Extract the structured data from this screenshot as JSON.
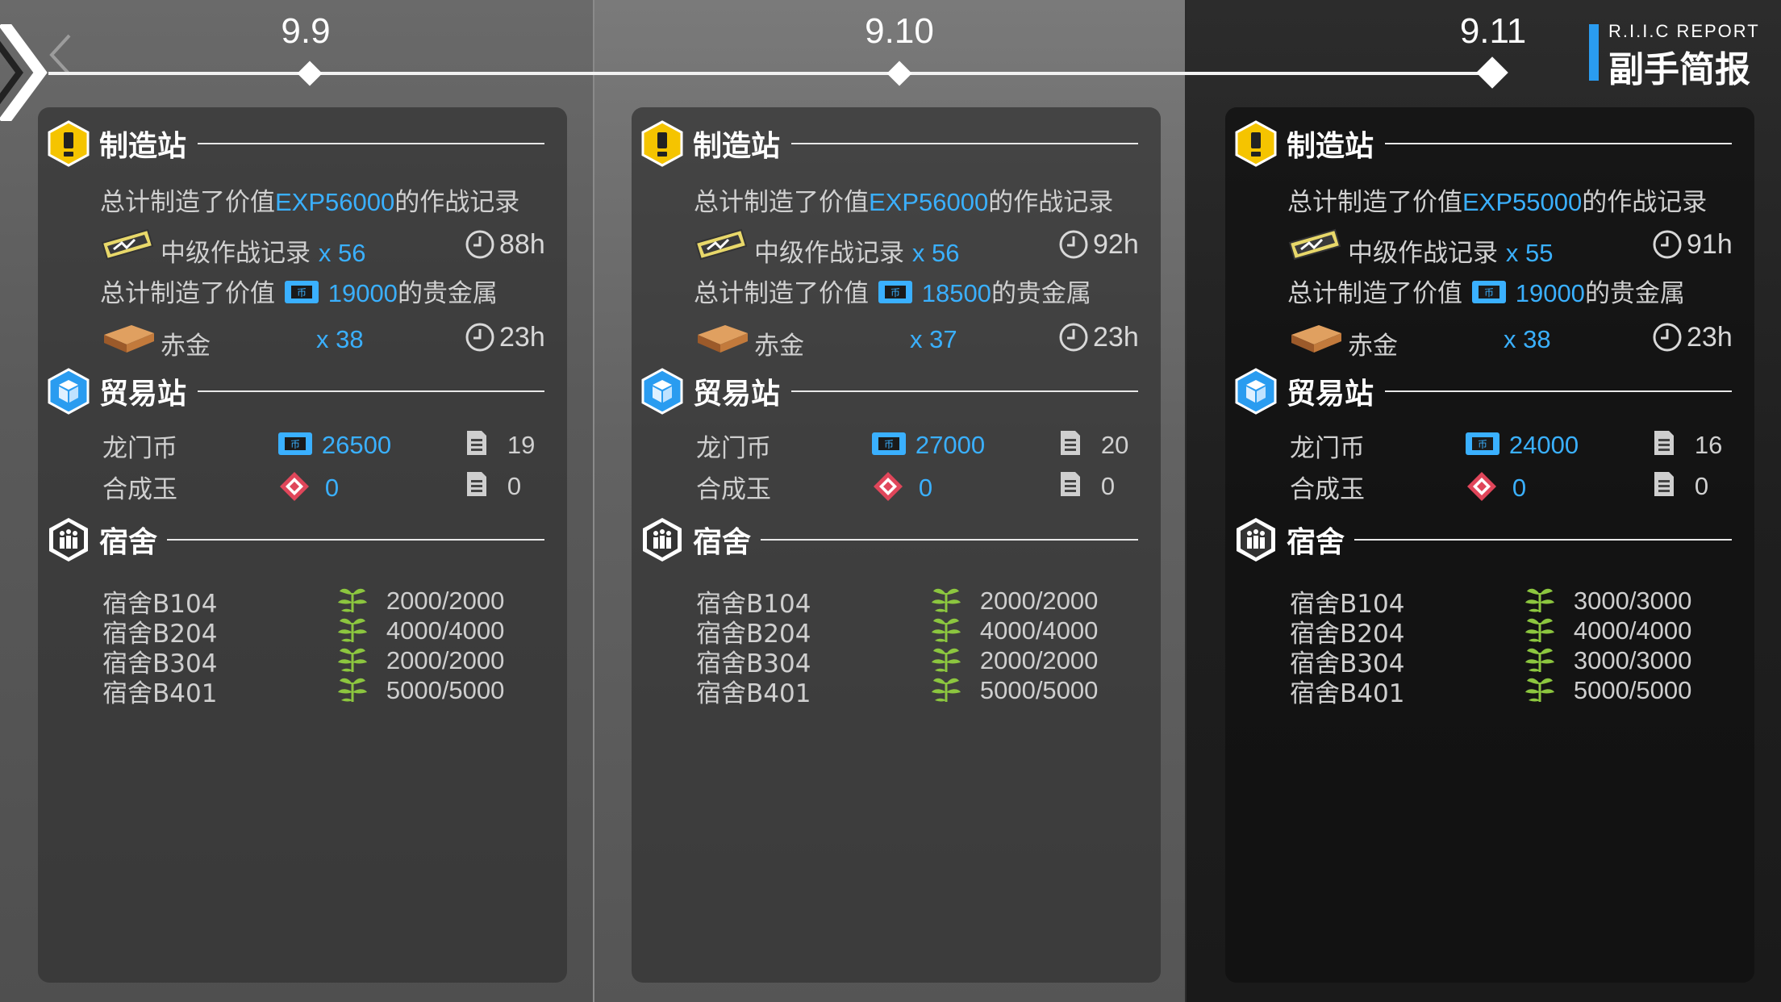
{
  "header": {
    "report_en": "R.I.I.C REPORT",
    "report_cn": "副手简报"
  },
  "timeline": {
    "dates": [
      "9.9",
      "9.10",
      "9.11"
    ]
  },
  "labels": {
    "manufacture": "制造站",
    "trade": "贸易站",
    "dorm": "宿舍",
    "exp_prefix": "总计制造了价值",
    "exp_suffix": "的作战记录",
    "gold_prefix": "总计制造了价值",
    "gold_suffix": "的贵金属",
    "record_name": "中级作战记录",
    "gold_name": "赤金",
    "lmd": "龙门币",
    "orundum": "合成玉"
  },
  "days": [
    {
      "exp": "EXP56000",
      "record_count": "x 56",
      "record_time": "88h",
      "gold_value": "19000",
      "gold_count": "x 38",
      "gold_time": "23h",
      "lmd": "26500",
      "lmd_orders": "19",
      "orundum": "0",
      "orundum_orders": "0",
      "dorms": [
        {
          "name": "宿舍B104",
          "value": "2000/2000"
        },
        {
          "name": "宿舍B204",
          "value": "4000/4000"
        },
        {
          "name": "宿舍B304",
          "value": "2000/2000"
        },
        {
          "name": "宿舍B401",
          "value": "5000/5000"
        }
      ]
    },
    {
      "exp": "EXP56000",
      "record_count": "x 56",
      "record_time": "92h",
      "gold_value": "18500",
      "gold_count": "x 37",
      "gold_time": "23h",
      "lmd": "27000",
      "lmd_orders": "20",
      "orundum": "0",
      "orundum_orders": "0",
      "dorms": [
        {
          "name": "宿舍B104",
          "value": "2000/2000"
        },
        {
          "name": "宿舍B204",
          "value": "4000/4000"
        },
        {
          "name": "宿舍B304",
          "value": "2000/2000"
        },
        {
          "name": "宿舍B401",
          "value": "5000/5000"
        }
      ]
    },
    {
      "exp": "EXP55000",
      "record_count": "x 55",
      "record_time": "91h",
      "gold_value": "19000",
      "gold_count": "x 38",
      "gold_time": "23h",
      "lmd": "24000",
      "lmd_orders": "16",
      "orundum": "0",
      "orundum_orders": "0",
      "dorms": [
        {
          "name": "宿舍B104",
          "value": "3000/3000"
        },
        {
          "name": "宿舍B204",
          "value": "4000/4000"
        },
        {
          "name": "宿舍B304",
          "value": "3000/3000"
        },
        {
          "name": "宿舍B401",
          "value": "5000/5000"
        }
      ]
    }
  ],
  "colors": {
    "accent_blue": "#3ab0ff",
    "report_bar": "#2a9cf0",
    "leaf_green": "#8cc63f",
    "manufacture_gold": "#f5c400"
  }
}
